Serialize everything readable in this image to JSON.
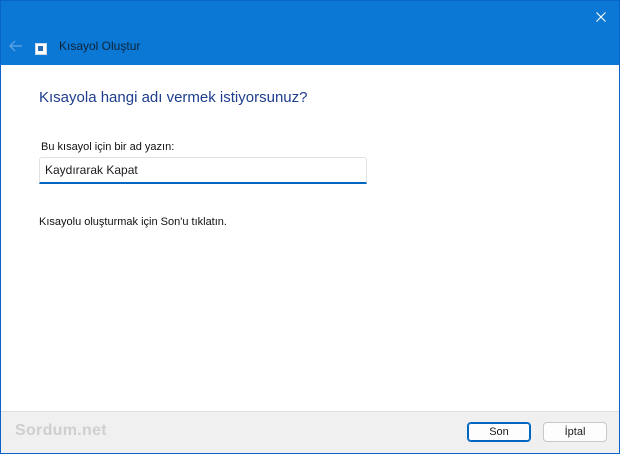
{
  "window": {
    "title": "Kısayol Oluştur",
    "accent_color": "#0a78d4",
    "icons": [
      "back-arrow-icon",
      "shortcut-app-icon",
      "close-icon"
    ]
  },
  "main": {
    "heading": "Kısayola hangi adı vermek istiyorsunuz?",
    "field_label": "Bu kısayol için bir ad yazın:",
    "name_value": "Kaydırarak Kapat",
    "instruction": "Kısayolu oluşturmak için Son'u tıklatın."
  },
  "footer": {
    "watermark": "Sordum.net",
    "finish_label": "Son",
    "cancel_label": "İptal"
  }
}
